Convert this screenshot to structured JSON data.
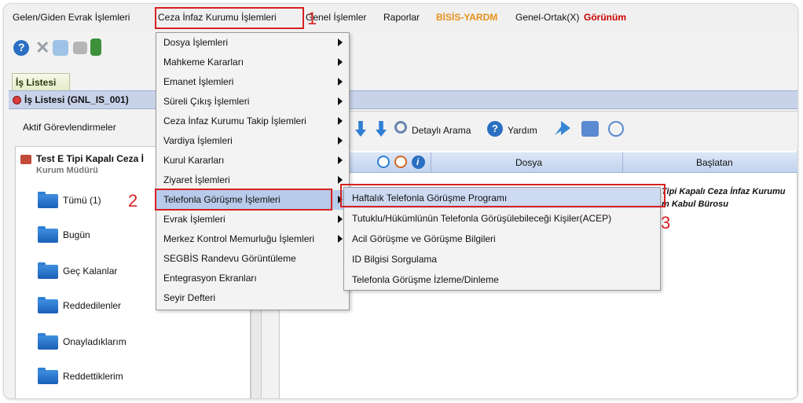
{
  "menubar": {
    "items": [
      {
        "label": "Gelen/Giden Evrak İşlemleri"
      },
      {
        "label": "Ceza İnfaz Kurumu İşlemleri"
      },
      {
        "label": "Genel İşlemler"
      },
      {
        "label": "Raporlar"
      },
      {
        "label": "BİSİS-YARDM"
      },
      {
        "label": "Genel-Ortak(X)"
      },
      {
        "label": "Görünüm"
      }
    ]
  },
  "steps": [
    "1",
    "2",
    "3"
  ],
  "tab": {
    "label": "İş Listesi"
  },
  "window": {
    "title": "İş Listesi (GNL_IS_001)"
  },
  "left": {
    "aktif": "Aktif Görevlendirmeler",
    "tree_title": "Test E Tipi Kapalı Ceza İ",
    "tree_subtitle": "Kurum Müdürü",
    "folders": [
      "Tümü (1)",
      "Bugün",
      "Geç Kalanlar",
      "Reddedilenler",
      "Onayladıklarım",
      "Reddettiklerim"
    ]
  },
  "toolbar": {
    "search": "Detaylı Arama",
    "help": "Yardım"
  },
  "table": {
    "headers": [
      "Dosya",
      "Başlatan"
    ],
    "row": {
      "line1": "Tipi Kapalı Ceza İnfaz Kurumu",
      "line2": "m Kabul Bürosu"
    }
  },
  "dropdown": {
    "items": [
      {
        "label": "Dosya İşlemleri",
        "submenu": true
      },
      {
        "label": "Mahkeme Kararları",
        "submenu": true
      },
      {
        "label": "Emanet İşlemleri",
        "submenu": true
      },
      {
        "label": "Süreli Çıkış İşlemleri",
        "submenu": true
      },
      {
        "label": "Ceza İnfaz Kurumu Takip İşlemleri",
        "submenu": true
      },
      {
        "label": "Vardiya İşlemleri",
        "submenu": true
      },
      {
        "label": "Kurul Kararları",
        "submenu": true
      },
      {
        "label": "Ziyaret İşlemleri",
        "submenu": true
      },
      {
        "label": "Telefonla Görüşme İşlemleri",
        "submenu": true
      },
      {
        "label": "Evrak İşlemleri",
        "submenu": true
      },
      {
        "label": "Merkez Kontrol Memurluğu İşlemleri",
        "submenu": true
      },
      {
        "label": "SEGBİS Randevu Görüntüleme",
        "submenu": false
      },
      {
        "label": "Entegrasyon Ekranları",
        "submenu": false
      },
      {
        "label": "Seyir Defteri",
        "submenu": false
      }
    ]
  },
  "submenu": {
    "items": [
      {
        "label": "Haftalık Telefonla Görüşme Programı"
      },
      {
        "label": "Tutuklu/Hükümlünün Telefonla Görüşülebileceği Kişiler(ACEP)"
      },
      {
        "label": "Acil Görüşme ve Görüşme Bilgileri"
      },
      {
        "label": "ID Bilgisi Sorgulama"
      },
      {
        "label": "Telefonla Görüşme İzleme/Dinleme"
      }
    ]
  }
}
